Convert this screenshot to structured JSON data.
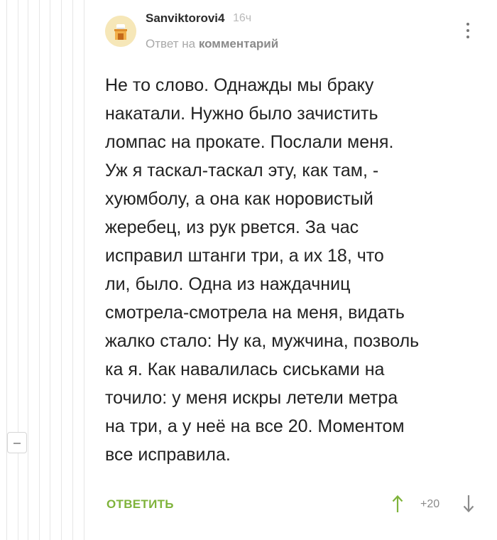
{
  "comment": {
    "username": "Sanviktorovi4",
    "time": "16ч",
    "reply_prefix": "Ответ на",
    "reply_link": "комментарий",
    "text_lines": [
      "Не то слово. Однажды мы браку",
      "накатали. Нужно было зачистить",
      "ломпас на прокате. Послали меня.",
      "Уж я таскал-таскал эту, как там, -",
      "хуюмболу, а она как норовистый",
      "жеребец, из рук рвется. За час",
      "исправил штанги три, а их 18, что",
      "ли, было. Одна из наждачниц",
      "смотрела-смотрела на меня, видать",
      "жалко стало: Ну ка, мужчина, позволь",
      "ка я. Как навалилась сиськами на",
      "точило: у меня искры летели метра",
      "на три, а у неё на все 20. Моментом",
      "все исправила."
    ],
    "reply_label": "ОТВЕТИТЬ",
    "rating": "+20"
  },
  "icons": {
    "avatar": "avatar-image",
    "more": "more-vertical-icon",
    "up": "arrow-up-icon",
    "down": "arrow-down-icon",
    "collapse": "collapse-minus-icon"
  },
  "colors": {
    "accent_green": "#7fb33b",
    "muted_text": "#a9a9a9",
    "thread_line": "#e6e6e6"
  }
}
